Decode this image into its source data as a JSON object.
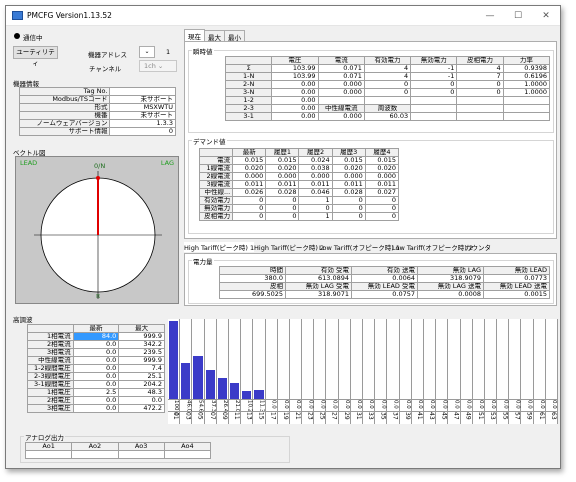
{
  "window": {
    "title": "PMCFG Version1.13.52",
    "min": "—",
    "max": "☐",
    "close": "✕"
  },
  "conn": {
    "status": "通信中",
    "status_color": "#000000"
  },
  "controls": {
    "utility_label": "ユーティリティ",
    "addr_label": "機器アドレス",
    "addr_value": "1",
    "channel_label": "チャンネル",
    "channel_value": "1ch"
  },
  "device_info": {
    "title": "機器情報",
    "rows": [
      [
        "Tag No.",
        ""
      ],
      [
        "Modbus/TSコード",
        "未サポート"
      ],
      [
        "形式",
        "MSXWTU"
      ],
      [
        "機番",
        "未サポート"
      ],
      [
        "ノームウェアバージョン",
        "1.3.3"
      ],
      [
        "サポート情報",
        "0"
      ]
    ]
  },
  "vector": {
    "title": "ベクトル図",
    "lead": "LEAD",
    "lag": "LAG",
    "top": "0/N",
    "bottom": "π"
  },
  "harmonic": {
    "title": "高調波",
    "headers": [
      "",
      "最新",
      "最大"
    ],
    "rows": [
      [
        "1相電流",
        "84.0",
        "999.9"
      ],
      [
        "2相電流",
        "0.0",
        "342.2"
      ],
      [
        "3相電流",
        "0.0",
        "239.5"
      ],
      [
        "中性線電流",
        "0.0",
        "999.9"
      ],
      [
        "1-2線間電圧",
        "0.0",
        "7.4"
      ],
      [
        "2-3線間電圧",
        "0.0",
        "25.1"
      ],
      [
        "3-1線間電圧",
        "0.0",
        "204.2"
      ],
      [
        "1相電圧",
        "2.5",
        "48.3"
      ],
      [
        "2相電圧",
        "0.0",
        "0.0"
      ],
      [
        "3相電圧",
        "0.0",
        "472.2"
      ]
    ]
  },
  "harmonic_chart": {
    "orders": [
      "01",
      "03",
      "05",
      "07",
      "09",
      "11",
      "13",
      "15",
      "17",
      "19",
      "21",
      "23",
      "25",
      "27",
      "29",
      "31",
      "33",
      "35",
      "37",
      "39",
      "41",
      "43",
      "45",
      "47",
      "49",
      "51",
      "53",
      "55",
      "57",
      "59",
      "61",
      "63"
    ],
    "values": [
      "100.0",
      "46.0",
      "54.6",
      "37.3",
      "26.4",
      "21.0",
      "10.2",
      "11.3",
      "0.0",
      "0.0",
      "0.0",
      "0.0",
      "0.0",
      "0.0",
      "0.0",
      "0.0",
      "0.0",
      "0.0",
      "0.0",
      "0.0",
      "0.0",
      "0.0",
      "0.0",
      "0.0",
      "0.0",
      "0.0",
      "0.0",
      "0.0",
      "0.0",
      "0.0",
      "0.0",
      "0.0"
    ],
    "bar_color": "#3b3bc8",
    "y_max": 100
  },
  "analog": {
    "title": "アナログ出力",
    "headers": [
      "Ao1",
      "Ao2",
      "Ao3",
      "Ao4"
    ],
    "values": [
      "",
      "",
      "",
      ""
    ]
  },
  "top_tabs": [
    "現在",
    "最大",
    "最小"
  ],
  "measure": {
    "title": "瞬時値",
    "headers": [
      "",
      "電圧",
      "電流",
      "有効電力",
      "無効電力",
      "皮相電力",
      "力率"
    ],
    "rows": [
      [
        "Σ",
        "103.99",
        "0.071",
        "4",
        "-1",
        "4",
        "0.9398"
      ],
      [
        "1-N",
        "103.99",
        "0.071",
        "4",
        "-1",
        "7",
        "0.6196"
      ],
      [
        "2-N",
        "0.00",
        "0.000",
        "0",
        "0",
        "0",
        "1.0000"
      ],
      [
        "3-N",
        "0.00",
        "0.000",
        "0",
        "0",
        "0",
        "1.0000"
      ],
      [
        "1-2",
        "0.00",
        "",
        "",
        "",
        "",
        ""
      ],
      [
        "2-3",
        "0.00",
        "中性線電流",
        "周波数",
        "",
        "",
        ""
      ],
      [
        "3-1",
        "0.00",
        "0.000",
        "60.03",
        "",
        "",
        ""
      ]
    ]
  },
  "demand": {
    "title": "デマンド値",
    "headers": [
      "",
      "最新",
      "履歴1",
      "履歴2",
      "履歴3",
      "履歴4"
    ],
    "rows": [
      [
        "電流",
        "0.015",
        "0.015",
        "0.024",
        "0.015",
        "0.015"
      ],
      [
        "1線電流",
        "0.020",
        "0.020",
        "0.038",
        "0.020",
        "0.020"
      ],
      [
        "2線電流",
        "0.000",
        "0.000",
        "0.000",
        "0.000",
        "0.000"
      ],
      [
        "3線電流",
        "0.011",
        "0.011",
        "0.011",
        "0.011",
        "0.011"
      ],
      [
        "中性線...",
        "0.026",
        "0.028",
        "0.046",
        "0.028",
        "0.027"
      ],
      [
        "有効電力",
        "0",
        "0",
        "1",
        "0",
        "0"
      ],
      [
        "無効電力",
        "0",
        "0",
        "0",
        "0",
        "0"
      ],
      [
        "皮相電力",
        "0",
        "0",
        "1",
        "0",
        "0"
      ]
    ]
  },
  "tariff_tabs": [
    "High Tariff(ピーク時) 1",
    "High Tariff(ピーク時) 2",
    "Low Tariff(オフピーク時) 1",
    "Low Tariff(オフピーク時) 2",
    "カウンタ"
  ],
  "energy": {
    "title": "電力量",
    "rows": [
      [
        "時間",
        "有効 受電",
        "有効 送電",
        "無効 LAG",
        "無効 LEAD"
      ],
      [
        "380.0",
        "613.0894",
        "0.0064",
        "318.9079",
        "0.0773"
      ],
      [
        "皮相",
        "無効 LAG 受電",
        "無効 LEAD 受電",
        "無効 LAG 送電",
        "無効 LEAD 送電"
      ],
      [
        "699.5025",
        "318.9071",
        "0.0757",
        "0.0008",
        "0.0015"
      ]
    ]
  }
}
